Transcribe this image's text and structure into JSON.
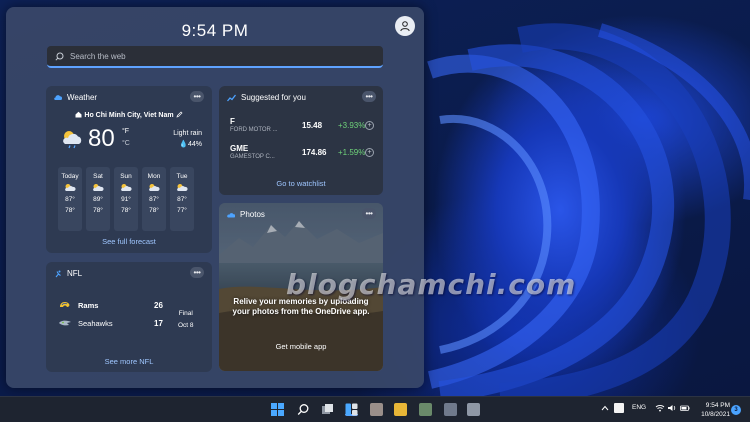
{
  "clock": "9:54 PM",
  "search": {
    "placeholder": "Search the web"
  },
  "weather": {
    "title": "Weather",
    "location": "Ho Chi Minh City, Viet Nam",
    "temperature": "80",
    "unit_f": "°F",
    "unit_c": "°C",
    "condition": "Light rain",
    "precip": "44%",
    "forecast": [
      {
        "day": "Today",
        "high": "87°",
        "low": "78°"
      },
      {
        "day": "Sat",
        "high": "89°",
        "low": "78°"
      },
      {
        "day": "Sun",
        "high": "91°",
        "low": "78°"
      },
      {
        "day": "Mon",
        "high": "87°",
        "low": "78°"
      },
      {
        "day": "Tue",
        "high": "87°",
        "low": "77°"
      }
    ],
    "link": "See full forecast"
  },
  "stocks": {
    "title": "Suggested for you",
    "items": [
      {
        "symbol": "F",
        "name": "FORD MOTOR ...",
        "price": "15.48",
        "change": "+3.93%"
      },
      {
        "symbol": "GME",
        "name": "GAMESTOP C...",
        "price": "174.86",
        "change": "+1.59%"
      }
    ],
    "link": "Go to watchlist"
  },
  "photos": {
    "title": "Photos",
    "message": "Relive your memories by uploading your photos from the OneDrive app.",
    "button": "Get mobile app"
  },
  "nfl": {
    "title": "NFL",
    "teams": [
      {
        "name": "Rams",
        "score": "26"
      },
      {
        "name": "Seahawks",
        "score": "17"
      }
    ],
    "status": "Final",
    "date": "Oct 8",
    "link": "See more NFL"
  },
  "watermark": "blogchamchi.com",
  "taskbar": {
    "language": "ENG",
    "time": "9:54 PM",
    "date": "10/8/2021",
    "notifications": "3"
  },
  "colors": {
    "accent": "#5ea2ff",
    "positive": "#6fd37a",
    "link": "#9fc6ff"
  }
}
